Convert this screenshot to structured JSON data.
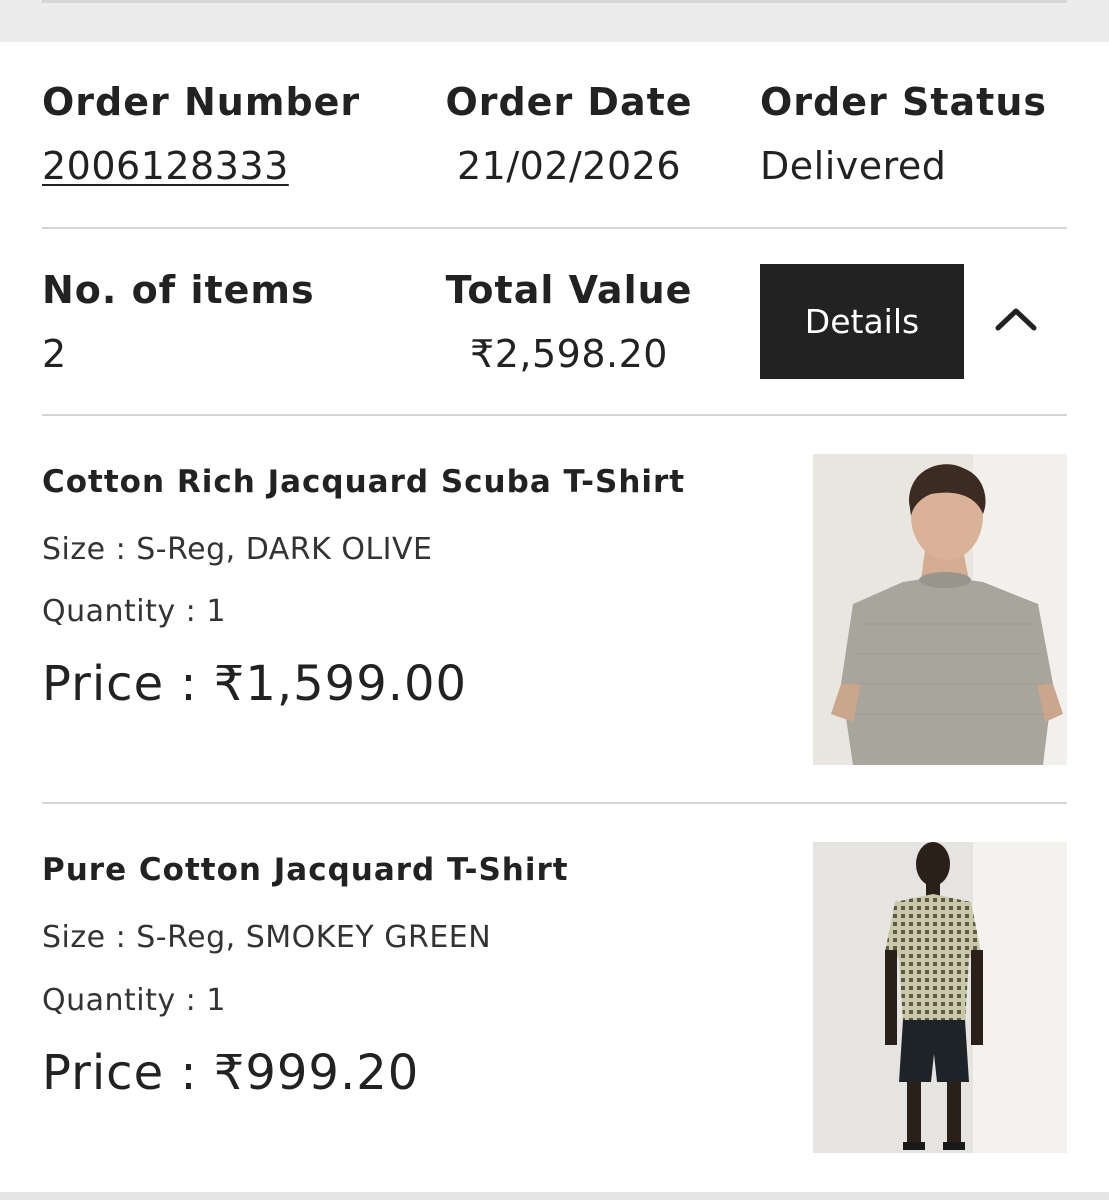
{
  "order": {
    "number_label": "Order Number",
    "number": "2006128333",
    "date_label": "Order Date",
    "date": "21/02/2026",
    "status_label": "Order Status",
    "status": "Delivered",
    "items_label": "No. of items",
    "items_count": "2",
    "total_label": "Total Value",
    "total": "₹2,598.20",
    "details_button": "Details",
    "collapse_icon": "chevron-up-icon"
  },
  "items": [
    {
      "name": "Cotton Rich Jacquard Scuba T-Shirt",
      "size": "Size : S-Reg, DARK OLIVE",
      "quantity": "Quantity : 1",
      "price": "Price : ₹1,599.00",
      "image": "grey-tshirt-model-photo"
    },
    {
      "name": "Pure Cotton Jacquard T-Shirt",
      "size": "Size : S-Reg, SMOKEY GREEN",
      "quantity": "Quantity : 1",
      "price": "Price : ₹999.20",
      "image": "checked-tshirt-model-photo"
    }
  ],
  "colors": {
    "button_bg": "#222222",
    "divider": "#d4d4d4",
    "page_bg": "#ececec"
  }
}
